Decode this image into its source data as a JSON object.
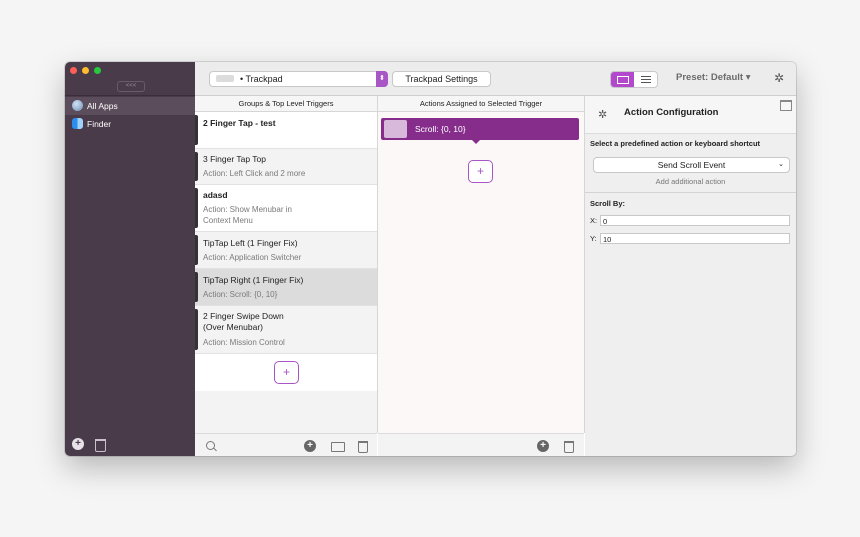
{
  "sidebar": {
    "collapse_label": "<<<",
    "items": [
      {
        "label": "All Apps",
        "icon": "globe-icon",
        "selected": true
      },
      {
        "label": "Finder",
        "icon": "finder-icon",
        "selected": false
      }
    ]
  },
  "toolbar": {
    "device": "Trackpad",
    "device_prefix": "•",
    "settings_label": "Trackpad Settings",
    "preset_label": "Preset: Default",
    "preset_arrow": "▾"
  },
  "columns": {
    "triggers_header": "Groups & Top Level Triggers",
    "actions_header": "Actions Assigned to Selected Trigger"
  },
  "triggers": [
    {
      "name": "2 Finger Tap - test",
      "action": ""
    },
    {
      "name": "3 Finger Tap Top",
      "action": "Action: Left Click and 2 more"
    },
    {
      "name": "adasd",
      "action_line1": "Action: Show Menubar in",
      "action_line2": "Context Menu"
    },
    {
      "name": "TipTap Left (1 Finger Fix)",
      "action": "Action: Application Switcher"
    },
    {
      "name": "TipTap Right (1 Finger Fix)",
      "action": "Action: Scroll: {0, 10}"
    },
    {
      "name_line1": "2 Finger Swipe Down",
      "name_line2": "(Over Menubar)",
      "action": "Action: Mission Control"
    }
  ],
  "actions": [
    {
      "label": "Scroll: {0, 10}"
    }
  ],
  "config": {
    "title": "Action Configuration",
    "subtitle": "Select a predefined action or keyboard shortcut",
    "selected_action": "Send Scroll Event",
    "add_additional": "Add additional action",
    "scroll_by_label": "Scroll By:",
    "x_label": "X:",
    "x_value": "0",
    "y_label": "Y:",
    "y_value": "10"
  },
  "glyphs": {
    "plus": "+",
    "chevron": "⌄",
    "updown": "⬍",
    "gear": "✲"
  },
  "colors": {
    "accent": "#a855c5",
    "action_bg": "#862d8c",
    "sidebar_bg": "#4a3b4a"
  }
}
